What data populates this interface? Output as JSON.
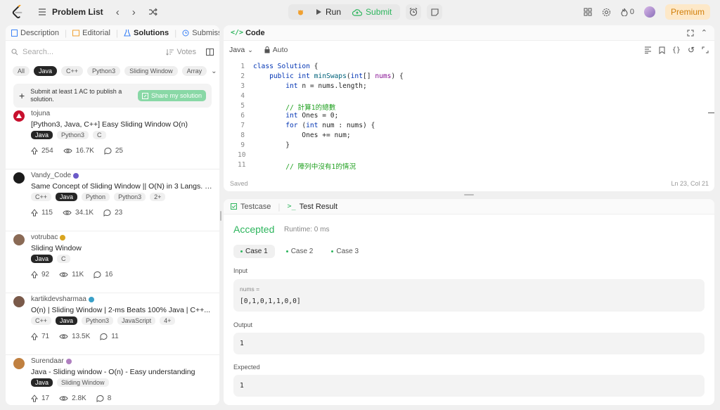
{
  "topbar": {
    "problem_list": "Problem List",
    "run": "Run",
    "submit": "Submit",
    "streak": "0",
    "premium": "Premium"
  },
  "left": {
    "tabs": [
      {
        "label": "Description"
      },
      {
        "label": "Editorial"
      },
      {
        "label": "Solutions"
      },
      {
        "label": "Submissions"
      }
    ],
    "search_placeholder": "Search...",
    "sort_label": "Votes",
    "chips": [
      "All",
      "Java",
      "C++",
      "Python3",
      "Sliding Window",
      "Array"
    ],
    "notice": "Submit at least 1 AC to publish a solution.",
    "share": "Share my solution",
    "posts": [
      {
        "author": "tojuna",
        "title": "[Python3, Java, C++] Easy Sliding Window O(n)",
        "tags": [
          "Java",
          "Python3",
          "C"
        ],
        "votes": "254",
        "views": "16.7K",
        "comments": "25"
      },
      {
        "author": "Vandy_Code",
        "title": "Same Concept of Sliding Window || O(N) in 3 Langs. ||...",
        "tags": [
          "C++",
          "Java",
          "Python",
          "Python3",
          "2+"
        ],
        "votes": "115",
        "views": "34.1K",
        "comments": "23"
      },
      {
        "author": "votrubac",
        "title": "Sliding Window",
        "tags": [
          "Java",
          "C"
        ],
        "votes": "92",
        "views": "11K",
        "comments": "16"
      },
      {
        "author": "kartikdevsharmaa",
        "title": "O(n) | Sliding Window | 2-ms Beats 100% Java | C++...",
        "tags": [
          "C++",
          "Java",
          "Python3",
          "JavaScript",
          "4+"
        ],
        "votes": "71",
        "views": "13.5K",
        "comments": "11"
      },
      {
        "author": "Surendaar",
        "title": "Java - Sliding window - O(n) - Easy understanding",
        "tags": [
          "Java",
          "Sliding Window"
        ],
        "votes": "17",
        "views": "2.8K",
        "comments": "8"
      }
    ]
  },
  "code": {
    "title": "Code",
    "language": "Java",
    "mode": "Auto",
    "line_numbers": [
      "1",
      "2",
      "3",
      "4",
      "5",
      "6",
      "7",
      "8",
      "9",
      "10",
      "11"
    ],
    "status": "Saved",
    "cursor": "Ln 23, Col 21"
  },
  "test": {
    "tab_testcase": "Testcase",
    "tab_result": "Test Result",
    "verdict": "Accepted",
    "runtime": "Runtime: 0 ms",
    "cases": [
      "Case 1",
      "Case 2",
      "Case 3"
    ],
    "input_label": "Input",
    "input_var": "nums =",
    "input_value": "[0,1,0,1,1,0,0]",
    "output_label": "Output",
    "output_value": "1",
    "expected_label": "Expected",
    "expected_value": "1"
  },
  "colors": {
    "accent_green": "#2db55d",
    "premium": "#d17f0a",
    "keyword": "#0033b3",
    "comment": "#20a020"
  }
}
